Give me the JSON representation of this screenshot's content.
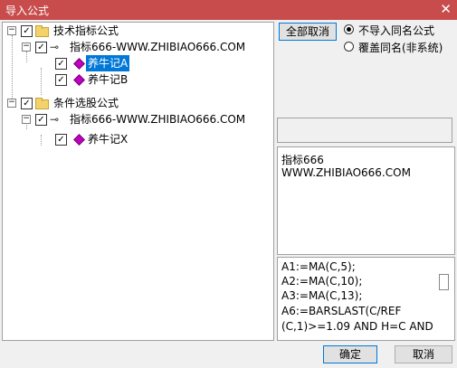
{
  "window": {
    "title": "导入公式",
    "close_glyph": "✕"
  },
  "tree": {
    "groups": [
      {
        "label": "技术指标公式",
        "child": {
          "label": "指标666-WWW.ZHIBIAO666.COM",
          "items": [
            "养牛记A",
            "养牛记B"
          ]
        }
      },
      {
        "label": "条件选股公式",
        "child": {
          "label": "指标666-WWW.ZHIBIAO666.COM",
          "items": [
            "养牛记X"
          ]
        }
      }
    ],
    "selected_item": "养牛记A",
    "check_glyph": "✓",
    "expander_glyph": "−",
    "key_glyph": "⊸"
  },
  "options": {
    "cancel_all_label": "全部取消",
    "radios": [
      {
        "label": "不导入同名公式",
        "checked": true
      },
      {
        "label": "覆盖同名(非系统)",
        "checked": false
      }
    ]
  },
  "description": {
    "lines": [
      "指标666",
      "WWW.ZHIBIAO666.COM"
    ]
  },
  "code": {
    "lines": [
      "A1:=MA(C,5);",
      "A2:=MA(C,10);",
      "A3:=MA(C,13);",
      "A6:=BARSLAST(C/REF",
      "(C,1)>=1.09  AND H=C AND"
    ]
  },
  "footer": {
    "ok_label": "确定",
    "cancel_label": "取消"
  }
}
